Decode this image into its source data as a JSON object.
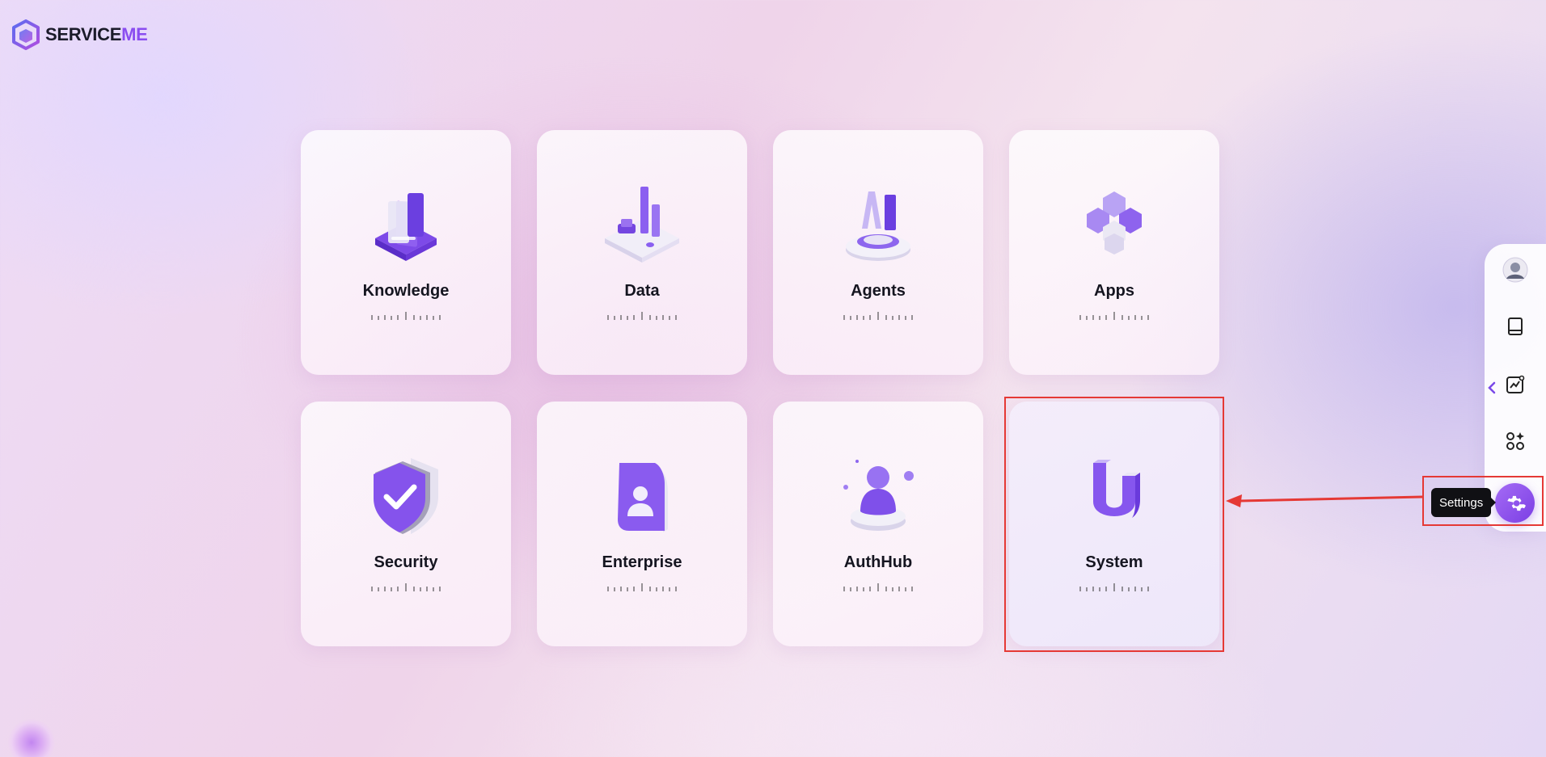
{
  "brand": {
    "name_main": "SERVICE",
    "name_accent": "ME"
  },
  "modules": [
    {
      "label": "Knowledge",
      "icon": "knowledge-books-icon"
    },
    {
      "label": "Data",
      "icon": "data-chart-icon"
    },
    {
      "label": "Agents",
      "icon": "agents-ai-icon"
    },
    {
      "label": "Apps",
      "icon": "apps-cubes-icon"
    },
    {
      "label": "Security",
      "icon": "security-shield-icon"
    },
    {
      "label": "Enterprise",
      "icon": "enterprise-badge-icon"
    },
    {
      "label": "AuthHub",
      "icon": "authhub-user-icon"
    },
    {
      "label": "System",
      "icon": "system-magnet-icon"
    }
  ],
  "dock": {
    "items": [
      "avatar",
      "notebook-icon",
      "analytics-icon",
      "apps-grid-icon"
    ],
    "settings_tooltip": "Settings"
  },
  "colors": {
    "accent": "#7b3fe4",
    "highlight": "#e53935"
  }
}
